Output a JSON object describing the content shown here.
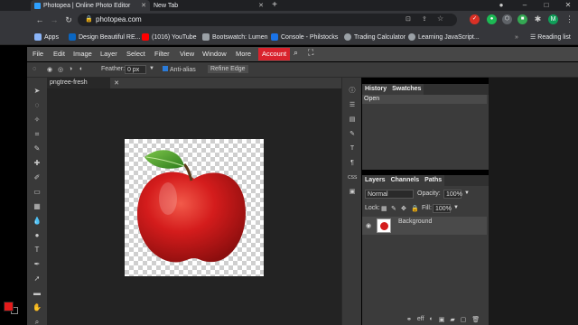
{
  "browser": {
    "tabs": [
      {
        "title": "Photopea | Online Photo Editor",
        "active": true
      },
      {
        "title": "New Tab",
        "active": false
      }
    ],
    "new_tab_symbol": "+",
    "url": "photopea.com",
    "profile_initial": "M",
    "reading_list": "Reading list",
    "bookmarks": [
      {
        "label": "Apps",
        "icon": "apps-grid-icon",
        "color": "#8ab4f8"
      },
      {
        "label": "Design Beautiful RE...",
        "icon": "linkedin-icon",
        "color": "#0a66c2"
      },
      {
        "label": "(1016) YouTube",
        "icon": "youtube-icon",
        "color": "#ff0000"
      },
      {
        "label": "Bootswatch: Lumen",
        "icon": "bootswatch-icon",
        "color": "#9aa0a6"
      },
      {
        "label": "Console - Philstocks",
        "icon": "philstocks-icon",
        "color": "#1a73e8"
      },
      {
        "label": "Trading Calculator",
        "icon": "globe-icon",
        "color": "#9aa0a6"
      },
      {
        "label": "Learning JavaScript...",
        "icon": "globe-icon",
        "color": "#9aa0a6"
      }
    ]
  },
  "photopea": {
    "menu": [
      "File",
      "Edit",
      "Image",
      "Layer",
      "Select",
      "Filter",
      "View",
      "Window",
      "More"
    ],
    "account": "Account",
    "options": {
      "feather_label": "Feather:",
      "feather_value": "0 px",
      "antialias": "Anti-alias",
      "refine_edge": "Refine Edge"
    },
    "document_tab": "pngtree-fresh",
    "history": {
      "tabs": [
        "History",
        "Swatches"
      ],
      "items": [
        "Open"
      ]
    },
    "layers": {
      "tabs": [
        "Layers",
        "Channels",
        "Paths"
      ],
      "blend_mode": "Normal",
      "opacity_label": "Opacity:",
      "opacity_value": "100%",
      "lock_label": "Lock:",
      "fill_label": "Fill:",
      "fill_value": "100%",
      "layer_name": "Background"
    },
    "bottom_labels": [
      "eff"
    ],
    "colors": {
      "foreground": "#e31b1b",
      "background": "#000000",
      "accent": "#d9232d"
    }
  }
}
